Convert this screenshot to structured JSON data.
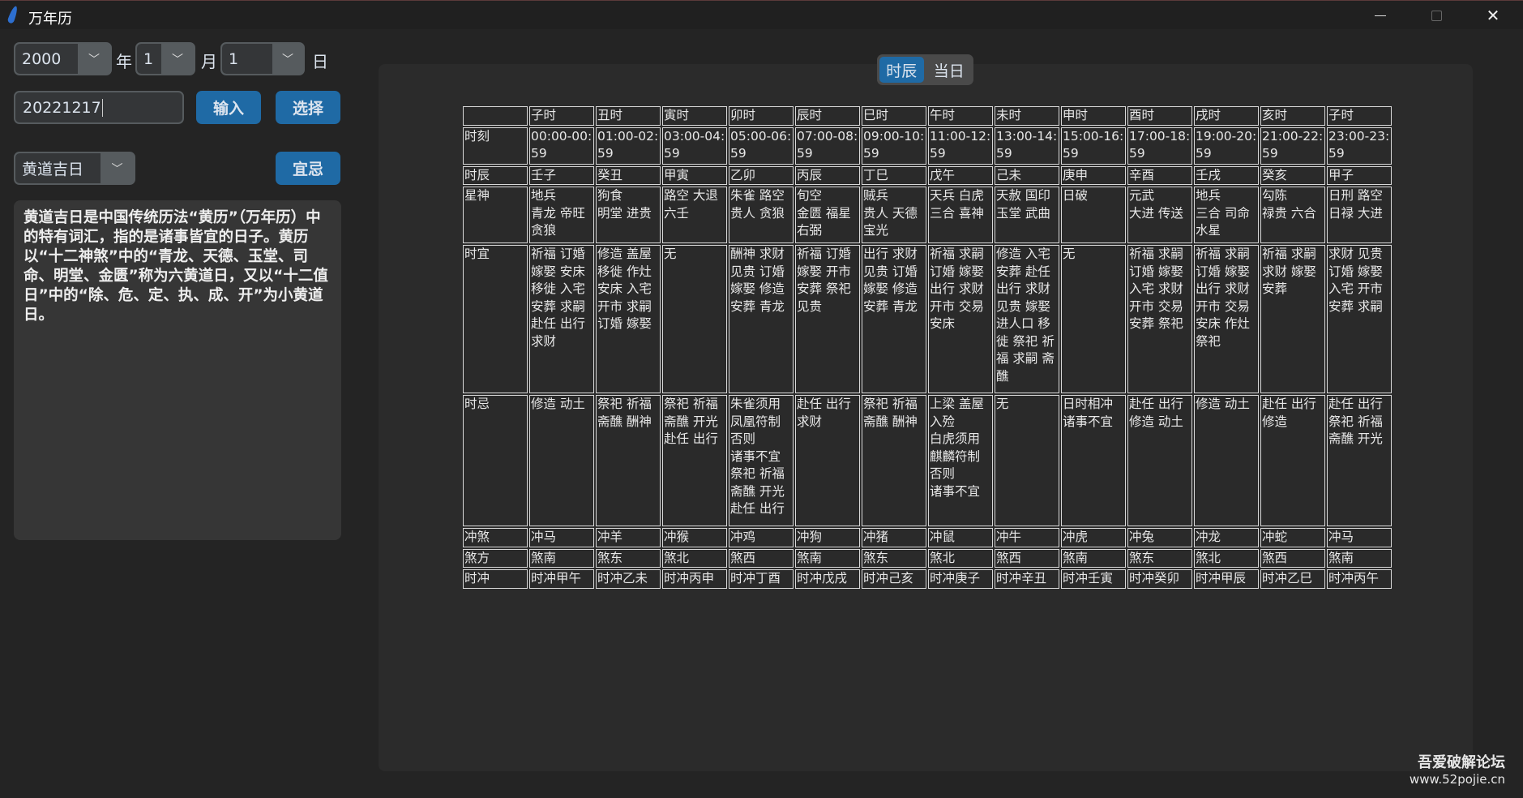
{
  "window": {
    "title": "万年历",
    "icon": "feather-icon"
  },
  "date_picker": {
    "year": "2000",
    "year_unit": "年",
    "month": "1",
    "month_unit": "月",
    "day": "1",
    "day_unit": "日"
  },
  "entry": {
    "value": "20221217"
  },
  "buttons": {
    "input": "输入",
    "select": "选择",
    "yiji": "宜忌"
  },
  "day_type": {
    "selected": "黄道吉日"
  },
  "description": "黄道吉日是中国传统历法“黄历”（万年历）中的特有词汇，指的是诸事皆宜的日子。黄历以“十二神煞”中的“青龙、天德、玉堂、司命、明堂、金匮”称为六黄道日，又以“十二值日”中的“除、危、定、执、成、开”为小黄道日。",
  "tabs": [
    {
      "label": "时辰",
      "selected": true
    },
    {
      "label": "当日",
      "selected": false
    }
  ],
  "table": {
    "header": [
      "",
      "子时",
      "丑时",
      "寅时",
      "卯时",
      "辰时",
      "巳时",
      "午时",
      "未时",
      "申时",
      "酉时",
      "戌时",
      "亥时",
      "子时"
    ],
    "rows": [
      {
        "label": "时刻",
        "cells": [
          "00:00-00:59",
          "01:00-02:59",
          "03:00-04:59",
          "05:00-06:59",
          "07:00-08:59",
          "09:00-10:59",
          "11:00-12:59",
          "13:00-14:59",
          "15:00-16:59",
          "17:00-18:59",
          "19:00-20:59",
          "21:00-22:59",
          "23:00-23:59"
        ]
      },
      {
        "label": "时辰",
        "cells": [
          "壬子",
          "癸丑",
          "甲寅",
          "乙卯",
          "丙辰",
          "丁巳",
          "戊午",
          "己未",
          "庚申",
          "辛酉",
          "壬戌",
          "癸亥",
          "甲子"
        ]
      },
      {
        "label": "星神",
        "cells": [
          "地兵\n青龙 帝旺 贪狼",
          "狗食\n明堂 进贵",
          "路空 大退 六壬",
          "朱雀 路空 贵人 贪狼",
          "旬空\n金匮 福星 右弼",
          "贼兵\n贵人 天德 宝光",
          "天兵 白虎 三合 喜神",
          "天赦 国印 玉堂 武曲",
          "日破",
          "元武\n大进 传送",
          "地兵\n三合 司命 水星",
          "勾陈\n禄贵 六合",
          "日刑 路空 日禄 大进"
        ]
      },
      {
        "label": "时宜",
        "cells": [
          "祈福 订婚 嫁娶 安床 移徙 入宅 安葬 求嗣 赴任 出行 求财",
          "修造 盖屋 移徙 作灶 安床 入宅 开市 求嗣 订婚 嫁娶",
          "无",
          "酬神 求财 见贵 订婚 嫁娶 修造 安葬 青龙",
          "祈福 订婚 嫁娶 开市 安葬 祭祀 见贵",
          "出行 求财 见贵 订婚 嫁娶 修造 安葬 青龙",
          "祈福 求嗣 订婚 嫁娶 出行 求财 开市 交易 安床",
          "修造 入宅 安葬 赴任 出行 求财 见贵 嫁娶 进人口 移徙 祭祀 祈福 求嗣 斋醮",
          "无",
          "祈福 求嗣 订婚 嫁娶 入宅 求财 开市 交易 安葬 祭祀",
          "祈福 求嗣 订婚 嫁娶 出行 求财 开市 交易 安床 作灶 祭祀",
          "祈福 求嗣 求财 嫁娶 安葬",
          "求财 见贵 订婚 嫁娶 入宅 开市 安葬 求嗣"
        ]
      },
      {
        "label": "时忌",
        "cells": [
          "修造 动土",
          "祭祀 祈福 斋醮 酬神",
          "祭祀 祈福 斋醮 开光 赴任 出行",
          "朱雀须用凤凰符制否则\n诸事不宜\n祭祀 祈福 斋醮 开光 赴任 出行",
          "赴任 出行 求财",
          "祭祀 祈福 斋醮 酬神",
          "上梁 盖屋 入殓\n白虎须用麒麟符制否则\n诸事不宜",
          "无",
          "日时相冲诸事不宜",
          "赴任 出行 修造 动土",
          "修造 动土",
          "赴任 出行 修造",
          "赴任 出行 祭祀 祈福 斋醮 开光"
        ]
      },
      {
        "label": "冲煞",
        "cells": [
          "冲马",
          "冲羊",
          "冲猴",
          "冲鸡",
          "冲狗",
          "冲猪",
          "冲鼠",
          "冲牛",
          "冲虎",
          "冲兔",
          "冲龙",
          "冲蛇",
          "冲马"
        ]
      },
      {
        "label": "煞方",
        "cells": [
          "煞南",
          "煞东",
          "煞北",
          "煞西",
          "煞南",
          "煞东",
          "煞北",
          "煞西",
          "煞南",
          "煞东",
          "煞北",
          "煞西",
          "煞南"
        ]
      },
      {
        "label": "时冲",
        "cells": [
          "时冲甲午",
          "时冲乙未",
          "时冲丙申",
          "时冲丁酉",
          "时冲戊戌",
          "时冲己亥",
          "时冲庚子",
          "时冲辛丑",
          "时冲壬寅",
          "时冲癸卯",
          "时冲甲辰",
          "时冲乙巳",
          "时冲丙午"
        ]
      }
    ]
  },
  "watermark": {
    "line1": "吾爱破解论坛",
    "line2": "www.52pojie.cn"
  },
  "colors": {
    "accent": "#1f6aa5",
    "background": "#242424",
    "panel": "#2b2b2b"
  }
}
